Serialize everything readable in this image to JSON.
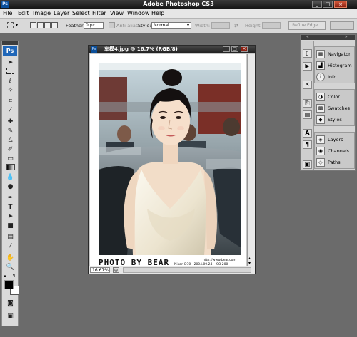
{
  "window": {
    "title": "Adobe Photoshop CS3",
    "app_icon": "Ps"
  },
  "menu": [
    "File",
    "Edit",
    "Image",
    "Layer",
    "Select",
    "Filter",
    "View",
    "Window",
    "Help"
  ],
  "options": {
    "feather_label": "Feather:",
    "feather_value": "0 px",
    "antialias_label": "Anti-alias",
    "style_label": "Style:",
    "style_value": "Normal",
    "width_label": "Width:",
    "height_label": "Height:",
    "refine_edge": "Refine Edge..."
  },
  "toolbox": {
    "logo": "Ps"
  },
  "document": {
    "title": "车模4.jpg @ 16.7% (RGB/8)",
    "zoom": "16.67%",
    "watermark": "PHOTO BY BEAR",
    "watermark_sub1": "http://www.bear.com",
    "watermark_sub2": "Nikon D70 · 2004.09.24 · ISO 200"
  },
  "panels": {
    "group1": [
      "Navigator",
      "Histogram",
      "Info"
    ],
    "group2": [
      "Color",
      "Swatches",
      "Styles"
    ],
    "group3": [
      "Layers",
      "Channels",
      "Paths"
    ]
  },
  "colors": {
    "foreground": "#000000",
    "background": "#ffffff",
    "accent": "#1f66b8"
  }
}
